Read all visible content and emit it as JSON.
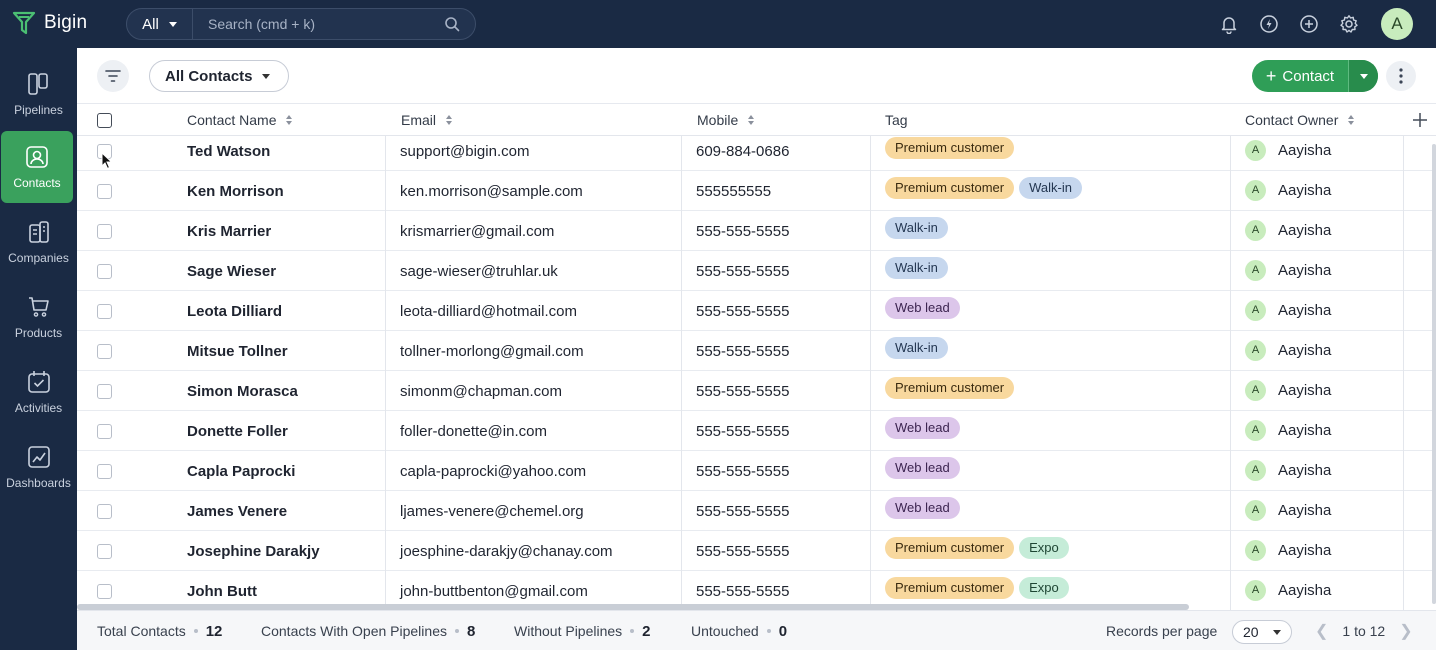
{
  "app": {
    "name": "Bigin",
    "brand_color": "#1a2a44",
    "accent_color": "#3aa15d"
  },
  "search": {
    "scope": "All",
    "placeholder": "Search (cmd + k)"
  },
  "top_icons": [
    "bell-icon",
    "compass-icon",
    "plus-circle-icon",
    "gear-icon"
  ],
  "user": {
    "initial": "A"
  },
  "sidebar": {
    "items": [
      {
        "label": "Pipelines",
        "icon": "pipelines-icon"
      },
      {
        "label": "Contacts",
        "icon": "contacts-icon",
        "active": true
      },
      {
        "label": "Companies",
        "icon": "companies-icon"
      },
      {
        "label": "Products",
        "icon": "cart-icon"
      },
      {
        "label": "Activities",
        "icon": "calendar-check-icon"
      },
      {
        "label": "Dashboards",
        "icon": "chart-icon"
      }
    ]
  },
  "toolbar": {
    "view": "All Contacts",
    "add_label": "Contact"
  },
  "table": {
    "columns": [
      "Contact Name",
      "Email",
      "Mobile",
      "Tag",
      "Contact Owner"
    ],
    "rows": [
      {
        "name": "Ted Watson",
        "email": "support@bigin.com",
        "mobile": "609-884-0686",
        "tags": [
          "Premium customer"
        ],
        "owner": "Aayisha"
      },
      {
        "name": "Ken Morrison",
        "email": "ken.morrison@sample.com",
        "mobile": "555555555",
        "tags": [
          "Premium customer",
          "Walk-in"
        ],
        "owner": "Aayisha"
      },
      {
        "name": "Kris Marrier",
        "email": "krismarrier@gmail.com",
        "mobile": "555-555-5555",
        "tags": [
          "Walk-in"
        ],
        "owner": "Aayisha"
      },
      {
        "name": "Sage Wieser",
        "email": "sage-wieser@truhlar.uk",
        "mobile": "555-555-5555",
        "tags": [
          "Walk-in"
        ],
        "owner": "Aayisha"
      },
      {
        "name": "Leota Dilliard",
        "email": "leota-dilliard@hotmail.com",
        "mobile": "555-555-5555",
        "tags": [
          "Web lead"
        ],
        "owner": "Aayisha"
      },
      {
        "name": "Mitsue Tollner",
        "email": "tollner-morlong@gmail.com",
        "mobile": "555-555-5555",
        "tags": [
          "Walk-in"
        ],
        "owner": "Aayisha"
      },
      {
        "name": "Simon Morasca",
        "email": "simonm@chapman.com",
        "mobile": "555-555-5555",
        "tags": [
          "Premium customer"
        ],
        "owner": "Aayisha"
      },
      {
        "name": "Donette Foller",
        "email": "foller-donette@in.com",
        "mobile": "555-555-5555",
        "tags": [
          "Web lead"
        ],
        "owner": "Aayisha"
      },
      {
        "name": "Capla Paprocki",
        "email": "capla-paprocki@yahoo.com",
        "mobile": "555-555-5555",
        "tags": [
          "Web lead"
        ],
        "owner": "Aayisha"
      },
      {
        "name": "James Venere",
        "email": "ljames-venere@chemel.org",
        "mobile": "555-555-5555",
        "tags": [
          "Web lead"
        ],
        "owner": "Aayisha"
      },
      {
        "name": "Josephine Darakjy",
        "email": "joesphine-darakjy@chanay.com",
        "mobile": "555-555-5555",
        "tags": [
          "Premium customer",
          "Expo"
        ],
        "owner": "Aayisha"
      },
      {
        "name": "John Butt",
        "email": "john-buttbenton@gmail.com",
        "mobile": "555-555-5555",
        "tags": [
          "Premium customer",
          "Expo"
        ],
        "owner": "Aayisha"
      }
    ],
    "tag_colors": {
      "Premium customer": "#f8d89e",
      "Walk-in": "#c6d7ee",
      "Web lead": "#dcc6ea",
      "Expo": "#c5ecd8"
    }
  },
  "footer": {
    "stats": [
      {
        "label": "Total Contacts",
        "value": "12"
      },
      {
        "label": "Contacts With Open Pipelines",
        "value": "8"
      },
      {
        "label": "Without Pipelines",
        "value": "2"
      },
      {
        "label": "Untouched",
        "value": "0"
      }
    ],
    "records_per_page_label": "Records per page",
    "records_per_page": "20",
    "range": "1 to 12"
  }
}
